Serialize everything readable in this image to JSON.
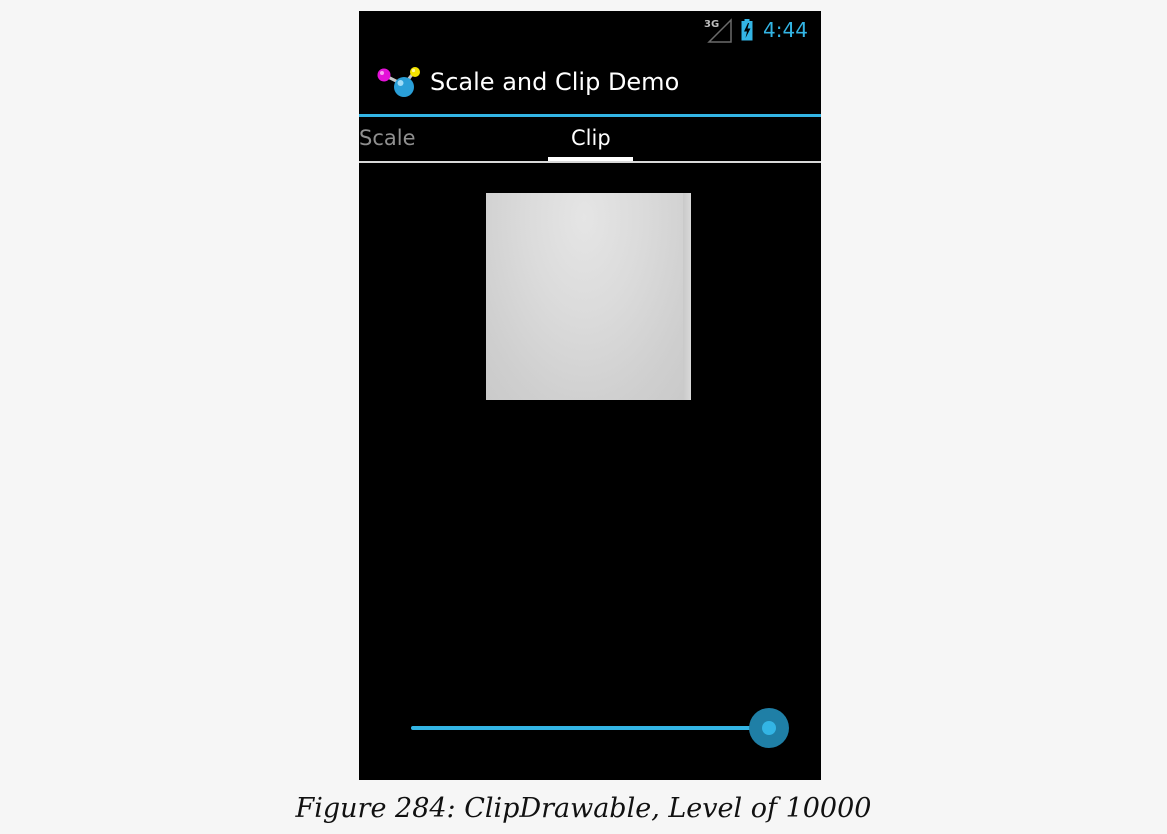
{
  "status_bar": {
    "network_label": "3G",
    "network_icon": "signal-3g-icon",
    "battery_icon": "battery-charging-icon",
    "clock": "4:44",
    "accent_color": "#33b5e5"
  },
  "action_bar": {
    "app_icon": "molecule-app-icon",
    "title": "Scale and Clip Demo"
  },
  "tabs": [
    {
      "label": "Scale",
      "selected": false
    },
    {
      "label": "Clip",
      "selected": true
    }
  ],
  "content": {
    "image_icon": "clip-drawable-image"
  },
  "seekbar": {
    "level": 10000,
    "max": 10000,
    "progress_fraction": 1.0,
    "color": "#33b5e5"
  },
  "caption": "Figure 284: ClipDrawable, Level of 10000"
}
